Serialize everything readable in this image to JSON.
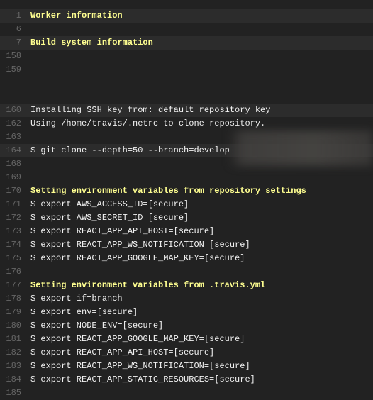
{
  "log": [
    {
      "num": "1",
      "text": "Worker information",
      "fold": true,
      "highlight": true
    },
    {
      "num": "6",
      "text": ""
    },
    {
      "num": "7",
      "text": "Build system information",
      "fold": true,
      "highlight": true
    },
    {
      "num": "158",
      "text": ""
    },
    {
      "num": "159",
      "text": ""
    },
    {
      "spacer": true
    },
    {
      "num": "160",
      "text": "Installing SSH key from: default repository key",
      "highlight": true
    },
    {
      "num": "162",
      "text": "Using /home/travis/.netrc to clone repository."
    },
    {
      "num": "163",
      "text": ""
    },
    {
      "num": "164",
      "text": "$ git clone --depth=50 --branch=develop",
      "highlight": true,
      "redacted": true
    },
    {
      "num": "168",
      "text": ""
    },
    {
      "num": "169",
      "text": ""
    },
    {
      "num": "170",
      "text": "Setting environment variables from repository settings",
      "fold": true
    },
    {
      "num": "171",
      "text": "$ export AWS_ACCESS_ID=[secure]"
    },
    {
      "num": "172",
      "text": "$ export AWS_SECRET_ID=[secure]"
    },
    {
      "num": "173",
      "text": "$ export REACT_APP_API_HOST=[secure]"
    },
    {
      "num": "174",
      "text": "$ export REACT_APP_WS_NOTIFICATION=[secure]"
    },
    {
      "num": "175",
      "text": "$ export REACT_APP_GOOGLE_MAP_KEY=[secure]"
    },
    {
      "num": "176",
      "text": ""
    },
    {
      "num": "177",
      "text": "Setting environment variables from .travis.yml",
      "fold": true
    },
    {
      "num": "178",
      "text": "$ export if=branch"
    },
    {
      "num": "179",
      "text": "$ export env=[secure]"
    },
    {
      "num": "180",
      "text": "$ export NODE_ENV=[secure]"
    },
    {
      "num": "181",
      "text": "$ export REACT_APP_GOOGLE_MAP_KEY=[secure]"
    },
    {
      "num": "182",
      "text": "$ export REACT_APP_API_HOST=[secure]"
    },
    {
      "num": "183",
      "text": "$ export REACT_APP_WS_NOTIFICATION=[secure]"
    },
    {
      "num": "184",
      "text": "$ export REACT_APP_STATIC_RESOURCES=[secure]"
    },
    {
      "num": "185",
      "text": ""
    }
  ],
  "colors": {
    "background": "#222222",
    "fold_text": "#ffff91",
    "text": "#f1f1f1",
    "line_number": "#666666"
  }
}
